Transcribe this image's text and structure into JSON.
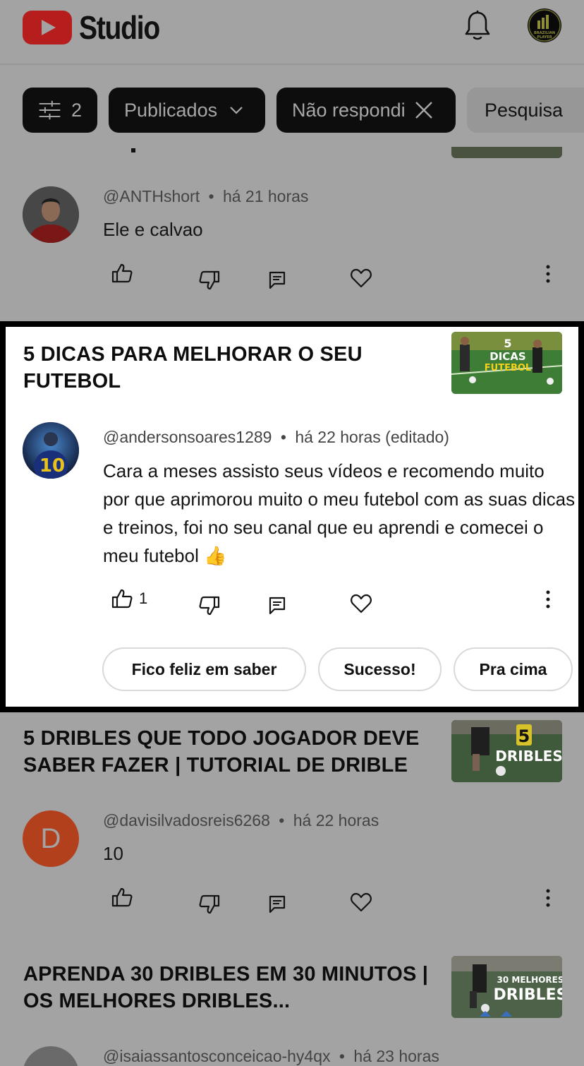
{
  "app": {
    "title": "Studio"
  },
  "filters": {
    "count_label": "2",
    "published_label": "Publicados",
    "unanswered_label": "Não respondi",
    "search_label": "Pesquisa"
  },
  "comments": [
    {
      "handle": "@ANTHshort",
      "time": "há 21 horas",
      "text": "Ele e calvao",
      "like_count": ""
    },
    {
      "video_title": "5  DICAS PARA MELHORAR O SEU FUTEBOL",
      "thumb_text_1": "5",
      "thumb_text_2": "DICAS",
      "thumb_text_3": "FUTEBOL",
      "handle": "@andersonsoares1289",
      "time": "há 22 horas (editado)",
      "text": "Cara a meses assisto seus vídeos e recomendo muito por que aprimorou muito o meu futebol com as suas dicas e treinos, foi no seu canal que eu aprendi e comecei o meu futebol 👍",
      "like_count": "1",
      "quick_replies": [
        "Fico feliz em saber",
        "Sucesso!",
        "Pra cima"
      ]
    },
    {
      "video_title": "5 DRIBLES QUE TODO JOGADOR DEVE SABER FAZER | TUTORIAL DE DRIBLE",
      "thumb_text_1": "5",
      "thumb_text_2": "DRIBLES",
      "avatar_letter": "D",
      "handle": "@davisilvadosreis6268",
      "time": "há 22 horas",
      "text": "10",
      "like_count": ""
    },
    {
      "video_title": "APRENDA 30 DRIBLES EM 30 MINUTOS | OS MELHORES DRIBLES...",
      "thumb_text_1": "30 MELHORES",
      "thumb_text_2": "DRIBLES",
      "handle": "@isaiassantosconceicao-hy4qx",
      "time": "há 23 horas"
    }
  ],
  "separator": "•",
  "colors": {
    "brand_red": "#b61d1d",
    "dim_overlay": "#a3a3a3",
    "avatar_d": "#b3401c"
  }
}
